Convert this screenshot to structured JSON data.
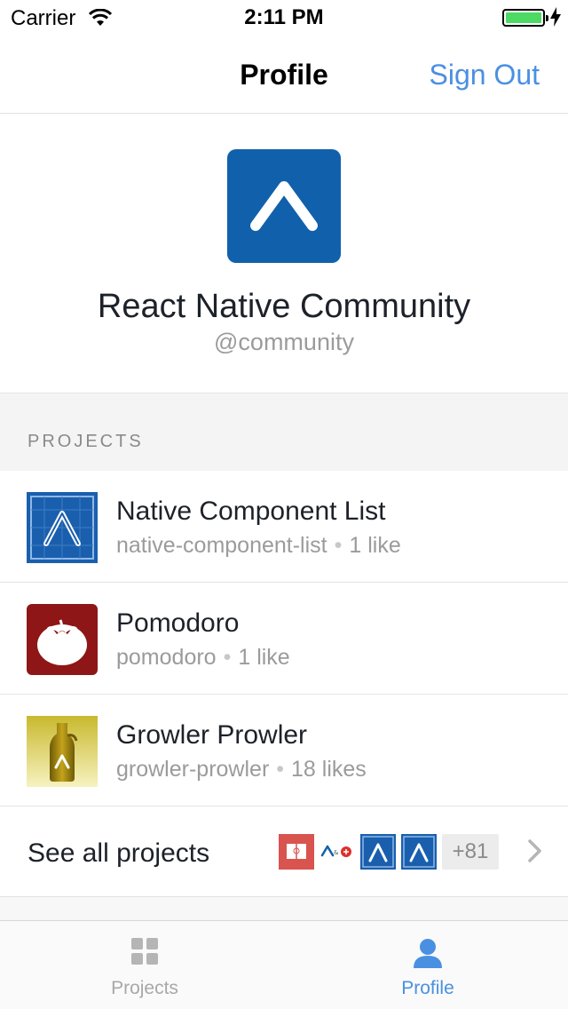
{
  "status_bar": {
    "carrier": "Carrier",
    "time": "2:11 PM"
  },
  "nav": {
    "title": "Profile",
    "right_button": "Sign Out",
    "accent_color": "#4a90e2"
  },
  "profile": {
    "name": "React Native Community",
    "handle": "@community",
    "avatar_color": "#1160ac"
  },
  "projects_section": {
    "title": "PROJECTS",
    "items": [
      {
        "name": "Native Component List",
        "slug": "native-component-list",
        "likes": "1 like",
        "icon": "blueprint-expo-icon"
      },
      {
        "name": "Pomodoro",
        "slug": "pomodoro",
        "likes": "1 like",
        "icon": "tomato-icon"
      },
      {
        "name": "Growler Prowler",
        "slug": "growler-prowler",
        "likes": "18 likes",
        "icon": "growler-bottle-icon"
      }
    ],
    "see_all_label": "See all projects",
    "more_count": "+81"
  },
  "tabs": [
    {
      "label": "Projects",
      "icon": "grid-icon",
      "active": false
    },
    {
      "label": "Profile",
      "icon": "person-icon",
      "active": true
    }
  ]
}
